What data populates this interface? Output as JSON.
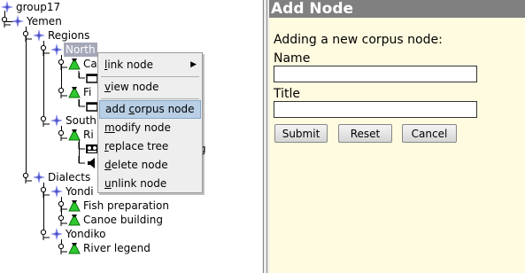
{
  "tree": {
    "group": "group17",
    "country": "Yemen",
    "regions": "Regions",
    "north": "North",
    "north_child_1": "Ca",
    "north_child_2": "Fi",
    "south": "South",
    "south_child_1": "Ri",
    "south_trailing_tail": "g",
    "dialects": "Dialects",
    "yondi_1": "Yondi",
    "fish_preparation": "Fish preparation",
    "canoe_building": "Canoe building",
    "yondiko": "Yondiko",
    "river_legend": "River legend"
  },
  "context_menu": {
    "items": [
      {
        "label": "link node",
        "underline": "l",
        "rest": "ink node",
        "has_submenu": true
      },
      {
        "label": "view node",
        "underline": "v",
        "rest": "iew node"
      },
      {
        "label": "add corpus node",
        "pre": "add ",
        "underline": "c",
        "rest": "orpus node",
        "active": true
      },
      {
        "label": "modify node",
        "underline": "m",
        "rest": "odify node"
      },
      {
        "label": "replace tree",
        "underline": "r",
        "rest": "eplace tree"
      },
      {
        "label": "delete node",
        "underline": "d",
        "rest": "elete node"
      },
      {
        "label": "unlink node",
        "underline": "u",
        "rest": "nlink node"
      }
    ],
    "submenu_arrow": "▶"
  },
  "panel": {
    "title": "Add Node",
    "intro": "Adding a new corpus node:",
    "name_label": "Name",
    "name_value": "",
    "title_label": "Title",
    "title_value": "",
    "submit_label": "Submit",
    "reset_label": "Reset",
    "cancel_label": "Cancel"
  },
  "colors": {
    "panel_bg": "#fffbe0",
    "panel_header": "#808080",
    "node_star": "#7b7fe6",
    "session_green": "#2ec82e",
    "menu_highlight": "#b8cfe5"
  },
  "icons": {
    "handle": "tree-toggle-handle",
    "star": "corpus-star-icon",
    "session": "session-bag-icon",
    "media": "media-file-icon",
    "audio": "audio-speaker-icon",
    "video": "video-film-icon"
  }
}
